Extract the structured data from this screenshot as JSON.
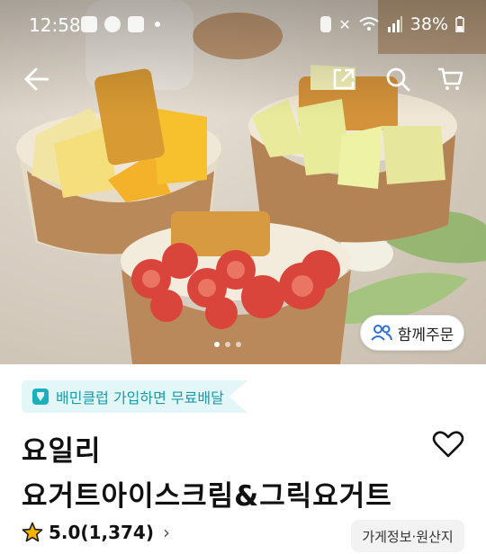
{
  "status_bar": {
    "time": "12:58",
    "battery": "38%"
  },
  "nav": {
    "back_icon": "back-arrow-icon",
    "share_icon": "share-icon",
    "search_icon": "search-icon",
    "cart_icon": "cart-icon"
  },
  "hero": {
    "group_order_label": "함께주문",
    "carousel_pages": 3,
    "carousel_active": 1
  },
  "promo": {
    "label": "배민클럽 가입하면 무료배달"
  },
  "store": {
    "name": "요일리",
    "subtitle": "요거트아이스크림&그릭요거트"
  },
  "rating": {
    "value": "5.0(1,374)",
    "chevron": "›",
    "star_color": "#f6b400"
  },
  "info_button": {
    "label": "가게정보·원산지"
  },
  "colors": {
    "promo_bg": "#e3f6f8",
    "promo_text": "#1a9ba6"
  }
}
